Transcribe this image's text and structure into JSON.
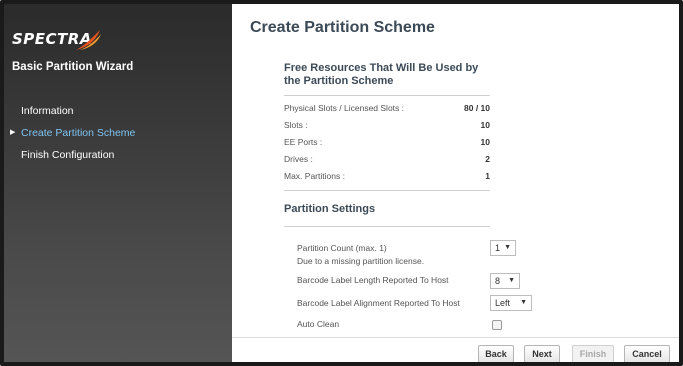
{
  "sidebar": {
    "logo_text": "SPECTRA",
    "wizard_title": "Basic Partition Wizard",
    "items": [
      {
        "label": "Information",
        "active": false
      },
      {
        "label": "Create Partition Scheme",
        "active": true
      },
      {
        "label": "Finish Configuration",
        "active": false
      }
    ]
  },
  "main": {
    "title": "Create Partition Scheme",
    "resources": {
      "title": "Free Resources That Will Be Used by the Partition Scheme",
      "rows": [
        {
          "label": "Physical Slots / Licensed Slots :",
          "value": "80 / 10"
        },
        {
          "label": "Slots :",
          "value": "10"
        },
        {
          "label": "EE Ports :",
          "value": "10"
        },
        {
          "label": "Drives :",
          "value": "2"
        },
        {
          "label": "Max. Partitions :",
          "value": "1"
        }
      ]
    },
    "settings": {
      "title": "Partition Settings",
      "partition_count_label": "Partition Count (max. 1)",
      "partition_count_note": "Due to a missing partition license.",
      "partition_count_value": "1",
      "barcode_length_label": "Barcode Label Length Reported To Host",
      "barcode_length_value": "8",
      "barcode_alignment_label": "Barcode Label Alignment Reported To Host",
      "barcode_alignment_value": "Left",
      "auto_clean_label": "Auto Clean",
      "auto_clean_checked": false
    }
  },
  "footer": {
    "back": "Back",
    "next": "Next",
    "finish": "Finish",
    "cancel": "Cancel"
  },
  "colors": {
    "active_nav": "#7fc4f2",
    "heading": "#3c4a57",
    "logo_swoosh": "#e8531f"
  }
}
